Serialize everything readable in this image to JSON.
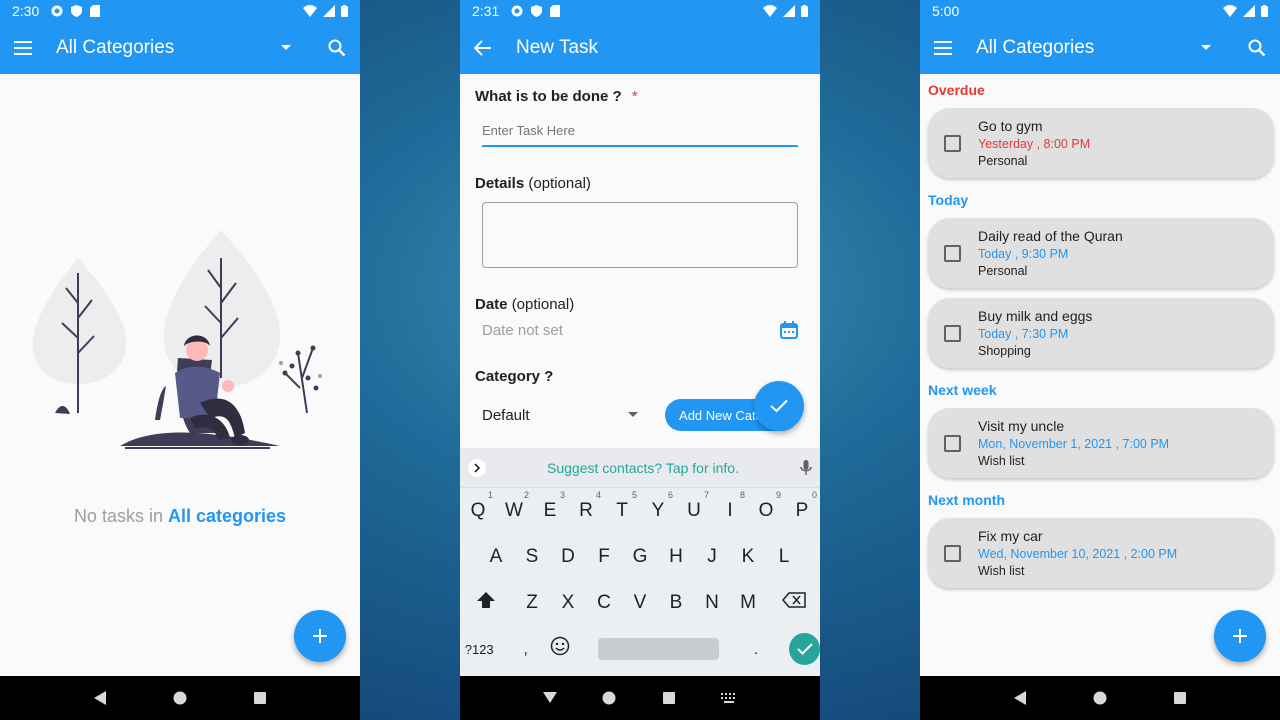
{
  "colors": {
    "primary": "#2196f3",
    "overdue": "#e53935",
    "accent": "#26a69a"
  },
  "screen1": {
    "status_time": "2:30",
    "title": "All Categories",
    "empty_prefix": "No tasks in",
    "empty_category": "All categories"
  },
  "screen2": {
    "status_time": "2:31",
    "title": "New Task",
    "task_label": "What is to be done ?",
    "required_mark": "*",
    "task_placeholder": "Enter Task Here",
    "details_label": "Details",
    "details_suffix": "(optional)",
    "date_label": "Date",
    "date_suffix": "(optional)",
    "date_value": "Date not set",
    "category_label": "Category ?",
    "category_value": "Default",
    "add_category_button": "Add New Category",
    "suggest_text": "Suggest contacts? Tap for info.",
    "keyboard": {
      "row1": [
        {
          "k": "Q",
          "n": "1"
        },
        {
          "k": "W",
          "n": "2"
        },
        {
          "k": "E",
          "n": "3"
        },
        {
          "k": "R",
          "n": "4"
        },
        {
          "k": "T",
          "n": "5"
        },
        {
          "k": "Y",
          "n": "6"
        },
        {
          "k": "U",
          "n": "7"
        },
        {
          "k": "I",
          "n": "8"
        },
        {
          "k": "O",
          "n": "9"
        },
        {
          "k": "P",
          "n": "0"
        }
      ],
      "row2": [
        "A",
        "S",
        "D",
        "F",
        "G",
        "H",
        "J",
        "K",
        "L"
      ],
      "row3": [
        "Z",
        "X",
        "C",
        "V",
        "B",
        "N",
        "M"
      ],
      "symbols_key": "?123",
      "comma_key": ",",
      "period_key": "."
    }
  },
  "screen3": {
    "status_time": "5:00",
    "title": "All Categories",
    "sections": [
      {
        "name": "Overdue",
        "color": "#e53935",
        "tasks": [
          {
            "title": "Go to gym",
            "date": "Yesterday , 8:00 PM",
            "category": "Personal"
          }
        ]
      },
      {
        "name": "Today",
        "color": "#2196f3",
        "tasks": [
          {
            "title": "Daily read of the Quran",
            "date": "Today , 9:30 PM",
            "category": "Personal"
          },
          {
            "title": "Buy milk and eggs",
            "date": "Today , 7:30 PM",
            "category": "Shopping"
          }
        ]
      },
      {
        "name": "Next week",
        "color": "#2196f3",
        "tasks": [
          {
            "title": "Visit my uncle",
            "date": "Mon, November 1, 2021 , 7:00 PM",
            "category": "Wish list"
          }
        ]
      },
      {
        "name": "Next month",
        "color": "#2196f3",
        "tasks": [
          {
            "title": "Fix my car",
            "date": "Wed, November 10, 2021 , 2:00 PM",
            "category": "Wish list"
          }
        ]
      }
    ]
  }
}
